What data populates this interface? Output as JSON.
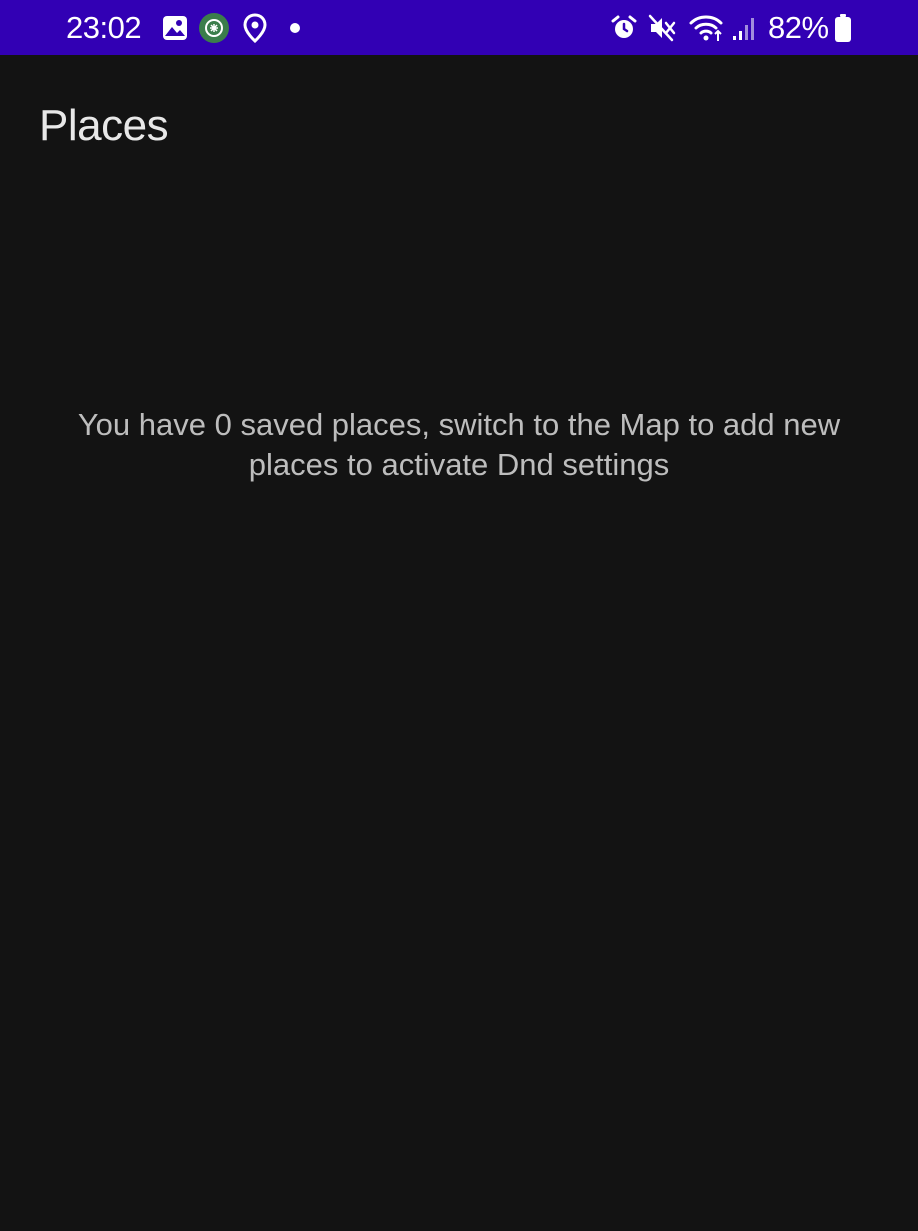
{
  "status_bar": {
    "time": "23:02",
    "battery": "82%",
    "colors": {
      "background": "#3200b4",
      "icon_bg_green": "#3b7d4b"
    },
    "left_icons": [
      "gallery-icon",
      "app-notification-icon",
      "location-icon",
      "dot-icon"
    ],
    "right_icons": [
      "alarm-icon",
      "mute-icon",
      "wifi-icon",
      "signal-icon",
      "battery-icon"
    ]
  },
  "screen": {
    "title": "Places",
    "empty_message": "You have 0 saved places, switch to the Map to add new places to activate Dnd settings"
  }
}
